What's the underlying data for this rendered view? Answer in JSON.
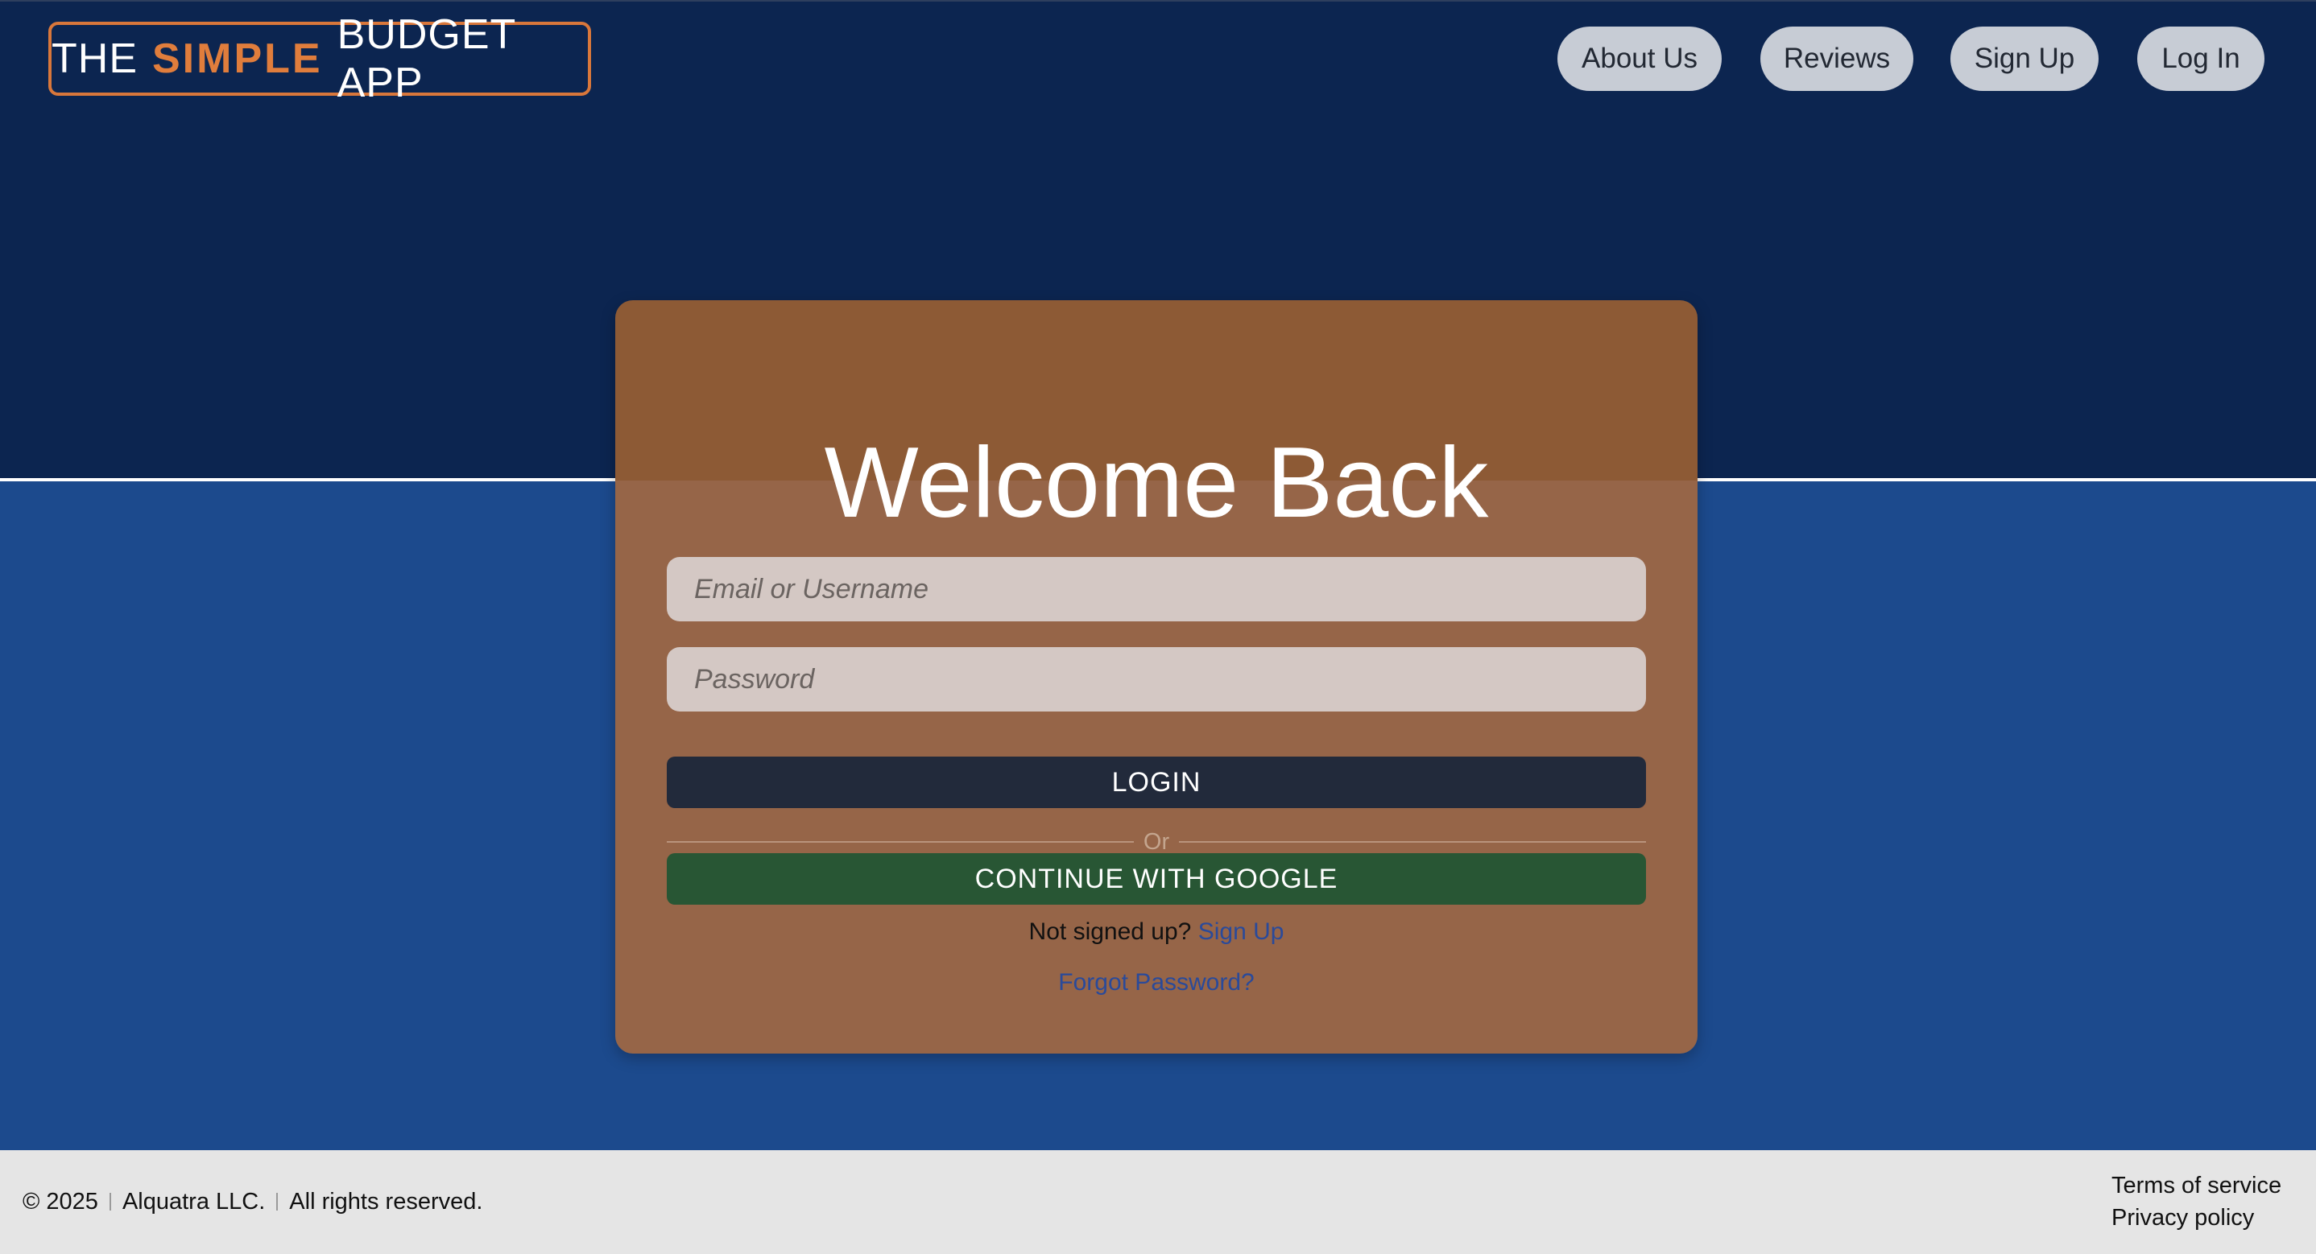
{
  "header": {
    "logo": {
      "part1": "THE",
      "part2": "SIMPLE",
      "part3": "BUDGET APP"
    },
    "nav": {
      "about": "About Us",
      "reviews": "Reviews",
      "signup": "Sign Up",
      "login": "Log In"
    }
  },
  "login_card": {
    "title": "Welcome Back",
    "email_placeholder": "Email or Username",
    "password_placeholder": "Password",
    "login_button": "LOGIN",
    "divider_text": "Or",
    "google_button": "CONTINUE WITH GOOGLE",
    "signup_prompt": "Not signed up?",
    "signup_link": "Sign Up",
    "forgot_link": "Forgot Password?"
  },
  "footer": {
    "copyright": "© 2025",
    "company": "Alquatra LLC.",
    "rights": "All rights reserved.",
    "terms": "Terms of service",
    "privacy": "Privacy policy"
  },
  "colors": {
    "navy_background": "#0c2550",
    "blue_background": "#1c4a8d",
    "brand_orange": "#e07d3c",
    "card_brown": "#966548",
    "login_button": "#222a3b",
    "google_button": "#285634",
    "link_blue": "#2a4a9a"
  }
}
